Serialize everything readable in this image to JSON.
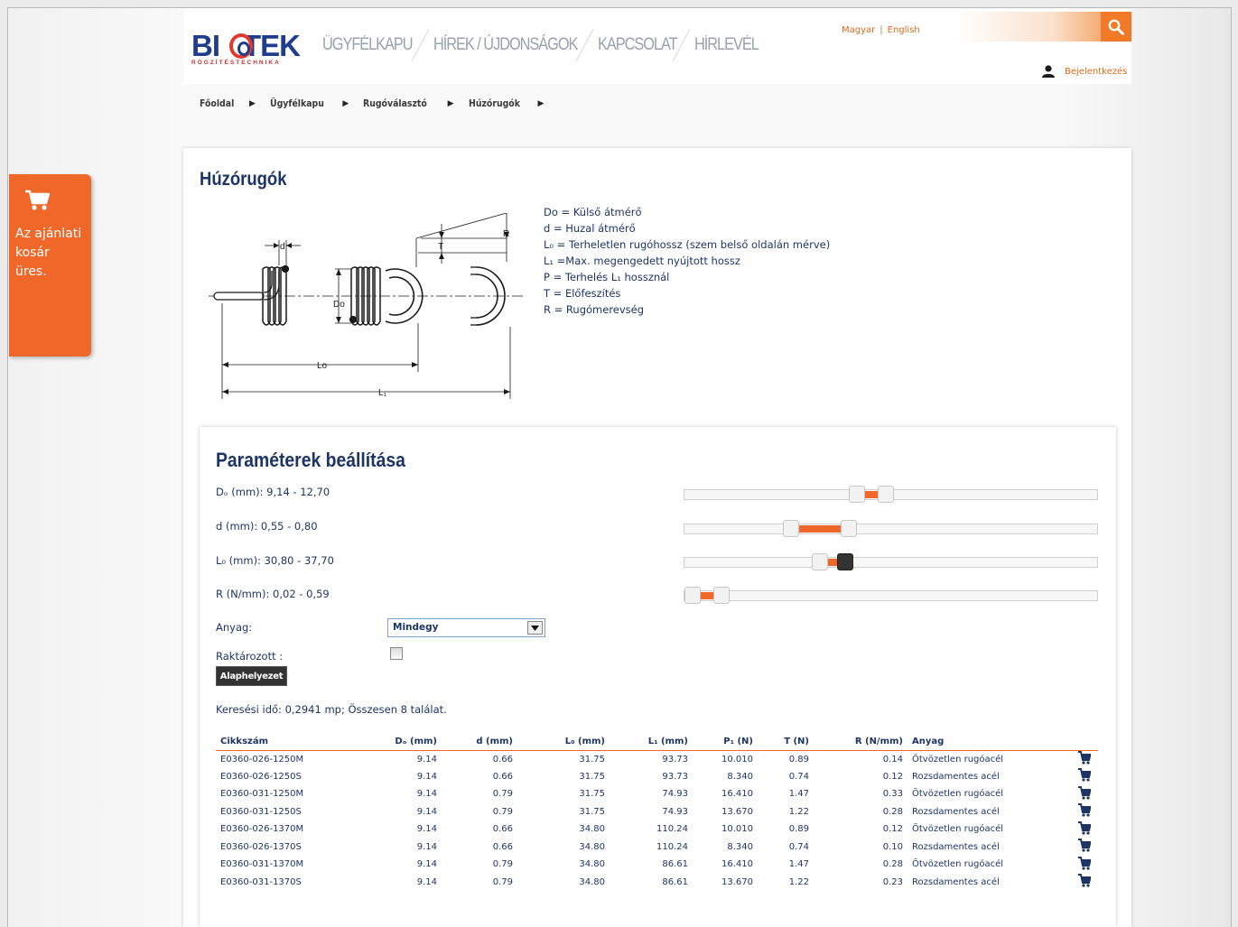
{
  "header": {
    "logo_text": "BIOTEK",
    "logo_subtext": "RÖGZÍTÉSTECHNIKA",
    "nav": [
      {
        "label": "ÜGYFÉLKAPU"
      },
      {
        "label": "HÍREK / ÚJDONSÁGOK"
      },
      {
        "label": "KAPCSOLAT"
      },
      {
        "label": "HÍRLEVÉL"
      }
    ],
    "lang_hu": "Magyar",
    "lang_sep": "|",
    "lang_en": "English",
    "search_placeholder": "",
    "login_label": "Bejelentkezés"
  },
  "breadcrumb": [
    "Főoldal",
    "Ügyfélkapu",
    "Rugóválasztó",
    "Húzórugók"
  ],
  "cart": {
    "text_line1": "Az ajánlati",
    "text_line2": "kosár",
    "text_line3": "üres."
  },
  "page": {
    "title": "Húzórugók",
    "diagram_labels": {
      "d": "d",
      "T": "T",
      "R": "R",
      "Do": "Do",
      "Lo": "Lo",
      "L1": "L₁"
    },
    "legend": [
      "Do = Külső átmérő",
      "d = Huzal átmérő",
      "L₀ = Terheletlen rugóhossz (szem belső oldalán mérve)",
      "L₁ =Max. megengedett nyújtott hossz",
      "P = Terhelés L₁ hossznál",
      "T = Előfeszítés",
      "R = Rugómerevség"
    ]
  },
  "params": {
    "title": "Paraméterek beállítása",
    "sliders": [
      {
        "label": "Dₒ (mm): 9,14 - 12,70",
        "range_min": 0.41,
        "range_max": 0.48
      },
      {
        "label": "d (mm): 0,55 - 0,80",
        "range_min": 0.25,
        "range_max": 0.39
      },
      {
        "label": "L₀ (mm): 30,80 - 37,70",
        "range_min": 0.32,
        "range_max": 0.38
      },
      {
        "label": "R (N/mm): 0,02 - 0,59",
        "range_min": 0.01,
        "range_max": 0.08
      }
    ],
    "material_label": "Anyag:",
    "material_value": "Mindegy",
    "stock_label": "Raktározott :",
    "reset_label": "Alaphelyezet",
    "search_info": "Keresési idő: 0,2941 mp; Összesen 8 találat."
  },
  "table": {
    "headers": [
      "Cikkszám",
      "Dₒ (mm)",
      "d (mm)",
      "L₀ (mm)",
      "L₁ (mm)",
      "P₁ (N)",
      "T (N)",
      "R (N/mm)",
      "Anyag"
    ],
    "rows": [
      [
        "E0360-026-1250M",
        "9.14",
        "0.66",
        "31.75",
        "93.73",
        "10.010",
        "0.89",
        "0.14",
        "Ötvözetlen rugóacél"
      ],
      [
        "E0360-026-1250S",
        "9.14",
        "0.66",
        "31.75",
        "93.73",
        "8.340",
        "0.74",
        "0.12",
        "Rozsdamentes acél"
      ],
      [
        "E0360-031-1250M",
        "9.14",
        "0.79",
        "31.75",
        "74.93",
        "16.410",
        "1.47",
        "0.33",
        "Ötvözetlen rugóacél"
      ],
      [
        "E0360-031-1250S",
        "9.14",
        "0.79",
        "31.75",
        "74.93",
        "13.670",
        "1.22",
        "0.28",
        "Rozsdamentes acél"
      ],
      [
        "E0360-026-1370M",
        "9.14",
        "0.66",
        "34.80",
        "110.24",
        "10.010",
        "0.89",
        "0.12",
        "Ötvözetlen rugóacél"
      ],
      [
        "E0360-026-1370S",
        "9.14",
        "0.66",
        "34.80",
        "110.24",
        "8.340",
        "0.74",
        "0.10",
        "Rozsdamentes acél"
      ],
      [
        "E0360-031-1370M",
        "9.14",
        "0.79",
        "34.80",
        "86.61",
        "16.410",
        "1.47",
        "0.28",
        "Ötvözetlen rugóacél"
      ],
      [
        "E0360-031-1370S",
        "9.14",
        "0.79",
        "34.80",
        "86.61",
        "13.670",
        "1.22",
        "0.23",
        "Rozsdamentes acél"
      ]
    ]
  },
  "colors": {
    "accent": "#f0672a",
    "brand": "#1f3d8c",
    "text": "#1d3565"
  }
}
